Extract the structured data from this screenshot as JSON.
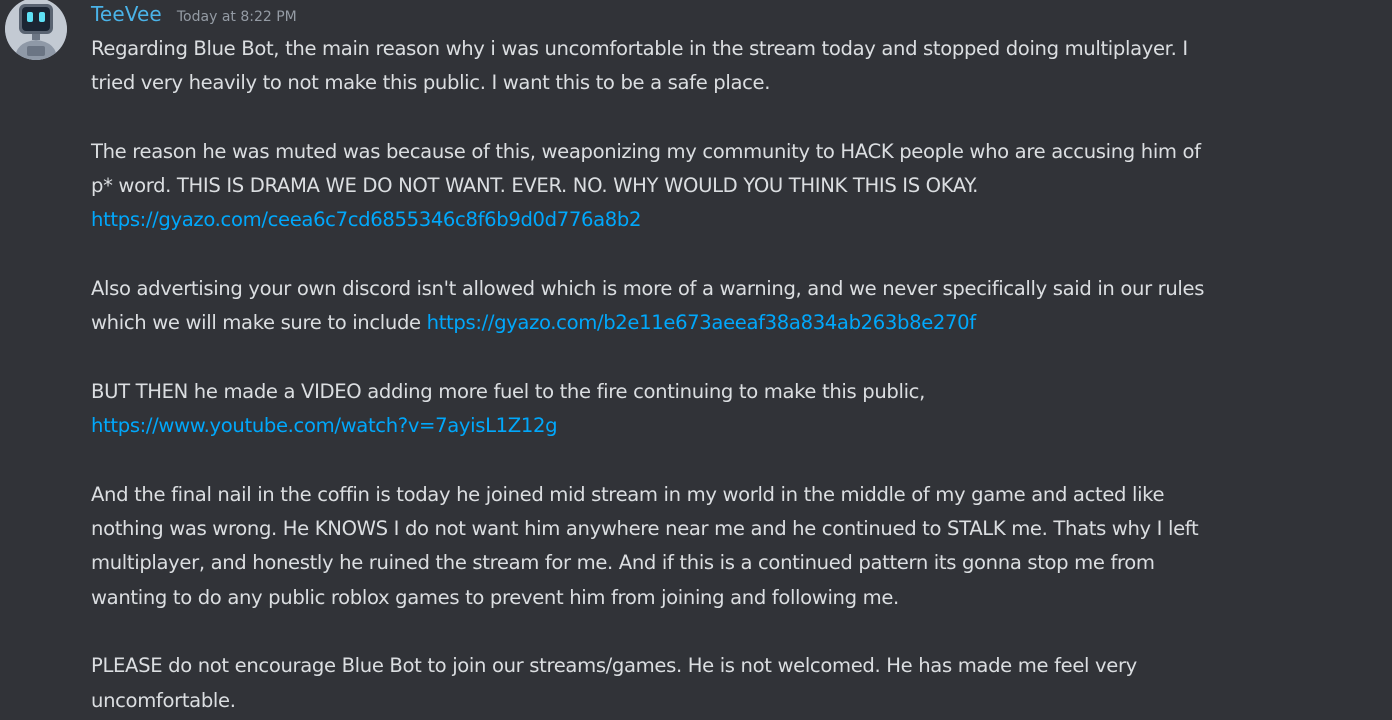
{
  "message": {
    "author": "TeeVee",
    "timestamp": "Today at 8:22 PM",
    "avatar_icon": "robot-tv-icon",
    "colors": {
      "background": "#313338",
      "username": "#4ab3e8",
      "text": "#dbdee1",
      "timestamp": "#949ba4",
      "link": "#00a8fc"
    },
    "paragraphs": [
      {
        "lines": [
          "Regarding Blue Bot, the main reason why i was uncomfortable in the stream today and stopped doing multiplayer. I",
          "tried very heavily to not make this public. I want this to be a safe place."
        ]
      },
      {
        "lines": [
          "The reason he was muted was because of this, weaponizing my community to HACK people who are accusing him of",
          "p* word. THIS IS DRAMA WE DO NOT WANT. EVER. NO. WHY WOULD YOU THINK THIS IS OKAY."
        ],
        "link": "https://gyazo.com/ceea6c7cd6855346c8f6b9d0d776a8b2"
      },
      {
        "lines": [
          "Also advertising your own discord isn't allowed which is more of a warning, and we never specifically said in our rules",
          "which we will make sure to include"
        ],
        "link": "https://gyazo.com/b2e11e673aeeaf38a834ab263b8e270f"
      },
      {
        "lines": [
          "BUT THEN he made a VIDEO adding more fuel to the fire continuing to make this public,"
        ],
        "link": "https://www.youtube.com/watch?v=7ayisL1Z12g"
      },
      {
        "lines": [
          "And the final nail in the coffin is today he joined mid stream in my world in the middle of my game and acted like",
          "nothing was wrong. He KNOWS I do not want him anywhere near me and he continued to STALK me. Thats why I left",
          "multiplayer, and honestly he ruined the stream for me. And if this is a continued pattern its gonna stop me from",
          "wanting to do any public roblox games to prevent him from joining and following me."
        ]
      },
      {
        "lines": [
          "PLEASE do not encourage Blue Bot to join our streams/games. He is not welcomed. He has made me feel very",
          "uncomfortable."
        ]
      }
    ]
  }
}
